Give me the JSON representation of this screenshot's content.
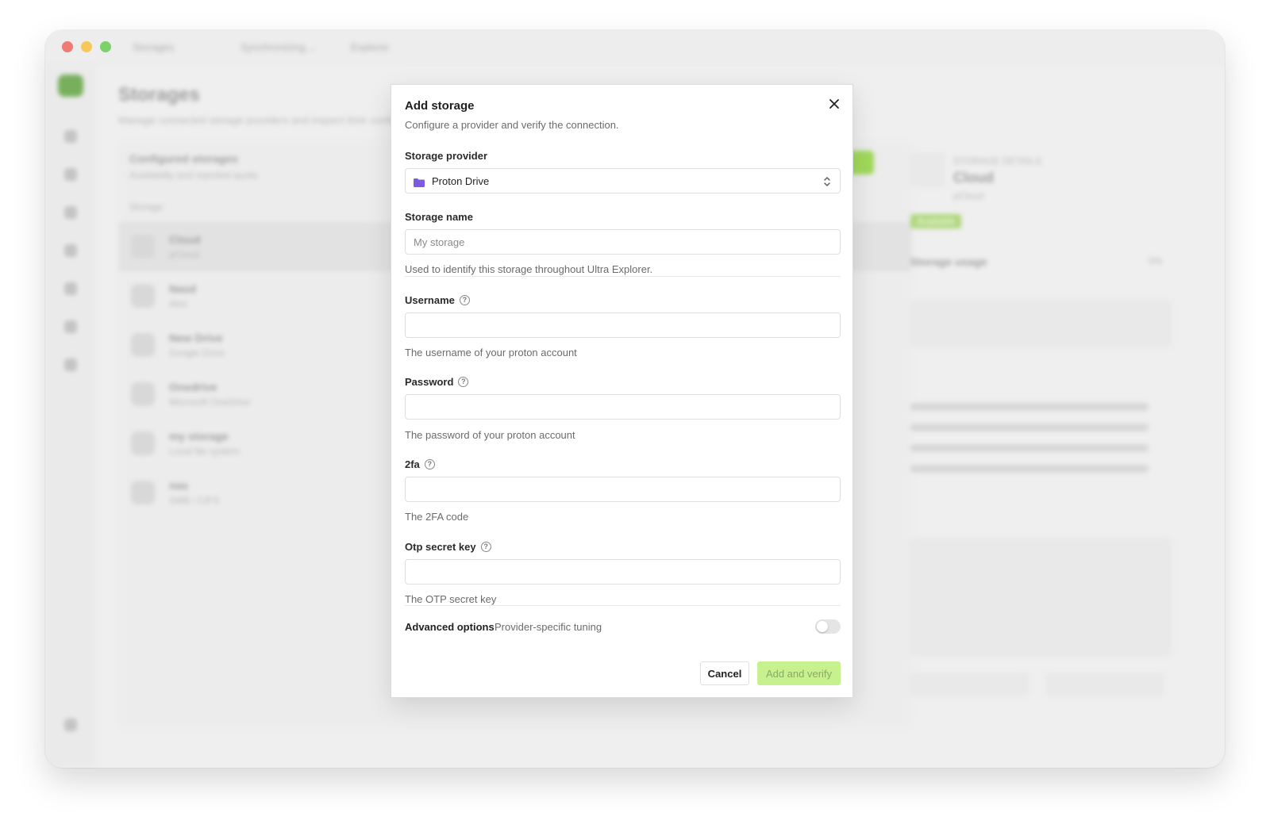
{
  "window": {
    "tabs": [
      "Storages",
      "Synchronizing…",
      "Explorer"
    ],
    "page_title": "Storages",
    "page_subtitle": "Manage connected storage providers and inspect their configuration",
    "list_title": "Configured storages",
    "list_subtitle": "Availability and reported quota",
    "list_column": "Storage",
    "storages": [
      {
        "name": "Cloud",
        "sub": "pCloud"
      },
      {
        "name": "Nasd",
        "sub": "Alist"
      },
      {
        "name": "New Drive",
        "sub": "Google Drive"
      },
      {
        "name": "Onedrive",
        "sub": "Microsoft OneDrive"
      },
      {
        "name": "my storage",
        "sub": "Local file system"
      },
      {
        "name": "nas",
        "sub": "SMB / CIFS"
      }
    ],
    "detail": {
      "kicker": "STORAGE DETAILS",
      "name": "Cloud",
      "provider": "pCloud",
      "badge": "Available",
      "usage_title": "Storage usage",
      "usage_pct": "0%"
    }
  },
  "modal": {
    "title": "Add storage",
    "description": "Configure a provider and verify the connection.",
    "provider_label": "Storage provider",
    "provider_value": "Proton Drive",
    "name_label": "Storage name",
    "name_placeholder": "My storage",
    "name_hint": "Used to identify this storage throughout Ultra Explorer.",
    "fields": [
      {
        "label": "Username",
        "hint": "The username of your proton account"
      },
      {
        "label": "Password",
        "hint": "The password of your proton account"
      },
      {
        "label": "2fa",
        "hint": "The 2FA code"
      },
      {
        "label": "Otp secret key",
        "hint": "The OTP secret key"
      }
    ],
    "advanced_label": "Advanced options",
    "advanced_sub": "Provider-specific tuning",
    "cancel_label": "Cancel",
    "submit_label": "Add and verify"
  },
  "colors": {
    "accent": "#c7f08f",
    "provider_icon": "#7b5be0"
  }
}
